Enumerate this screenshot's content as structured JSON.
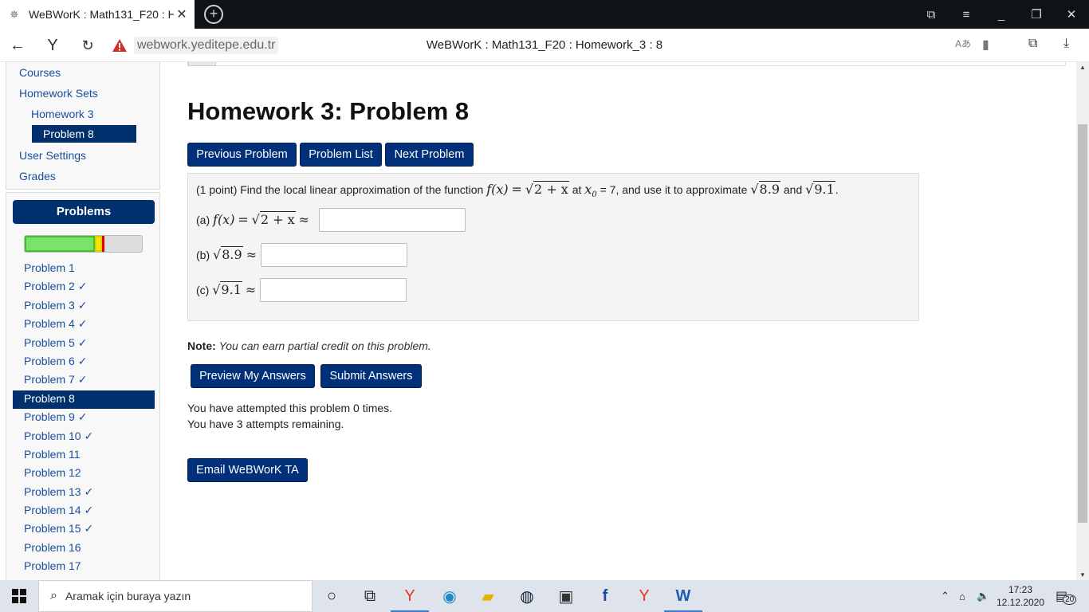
{
  "browser": {
    "tab_title": "WeBWorK : Math131_F20 : H",
    "url": "webwork.yeditepe.edu.tr",
    "page_title": "WeBWorK : Math131_F20 : Homework_3 : 8"
  },
  "sidebar": {
    "links": [
      "Courses",
      "Homework Sets",
      "Homework 3",
      "Problem 8",
      "User Settings",
      "Grades"
    ],
    "problems_header": "Problems",
    "progress": {
      "correct_fraction": 0.588,
      "partial_fraction": 0.059,
      "incorrect_fraction": 0.012
    },
    "problems": [
      "Problem 1",
      "Problem 2 ✓",
      "Problem 3 ✓",
      "Problem 4 ✓",
      "Problem 5 ✓",
      "Problem 6 ✓",
      "Problem 7 ✓",
      "Problem 8",
      "Problem 9 ✓",
      "Problem 10 ✓",
      "Problem 11",
      "Problem 12",
      "Problem 13 ✓",
      "Problem 14 ✓",
      "Problem 15 ✓",
      "Problem 16",
      "Problem 17"
    ]
  },
  "main": {
    "heading": "Homework 3: Problem 8",
    "nav_buttons": [
      "Previous Problem",
      "Problem List",
      "Next Problem"
    ],
    "problem": {
      "intro": "(1 point) Find the local linear approximation of the function",
      "func": "f(x)",
      "eq": "=",
      "radicand": "2 + x",
      "at": "at",
      "x0": "x",
      "x0_sub": "0",
      "x0_val": "= 7,",
      "use_text": "and use it to approximate",
      "r1": "8.9",
      "and_text": "and",
      "r2": "9.1",
      "dot": ".",
      "parts": [
        {
          "label": "(a)",
          "expr_func": "f(x)",
          "expr_eq": "=",
          "radicand": "2 + x",
          "approx": "≈",
          "value": ""
        },
        {
          "label": "(b)",
          "radicand": "8.9",
          "approx": "≈",
          "value": ""
        },
        {
          "label": "(c)",
          "radicand": "9.1",
          "approx": "≈",
          "value": ""
        }
      ]
    },
    "note_label": "Note:",
    "note_text": "You can earn partial credit on this problem.",
    "preview_button": "Preview My Answers",
    "submit_button": "Submit Answers",
    "attempted": "You have attempted this problem 0 times.",
    "remaining": "You have 3 attempts remaining.",
    "email_button": "Email WeBWorK TA"
  },
  "taskbar": {
    "search_placeholder": "Aramak için buraya yazın",
    "time": "17:23",
    "date": "12.12.2020",
    "notifications": "20"
  }
}
